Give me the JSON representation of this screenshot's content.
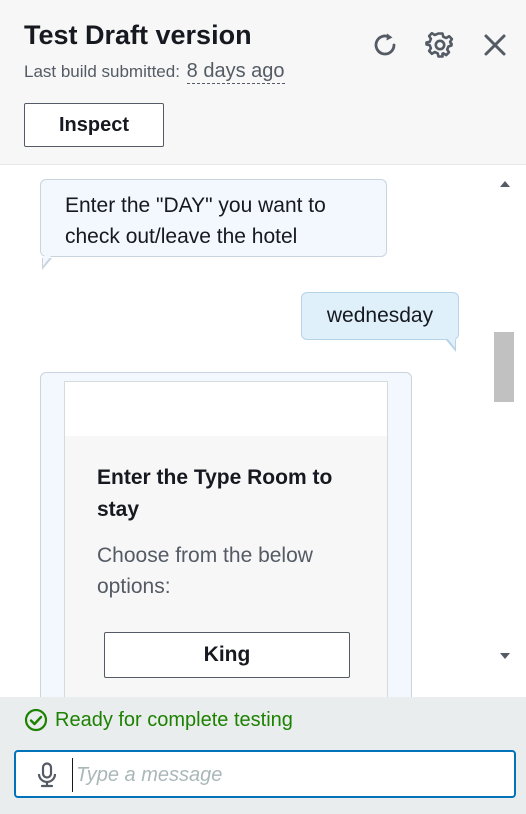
{
  "header": {
    "title": "Test Draft version",
    "subtitle_prefix": "Last build submitted:",
    "subtitle_time": "8 days ago",
    "inspect_label": "Inspect",
    "icons": [
      "refresh-icon",
      "gear-icon",
      "close-icon"
    ]
  },
  "conversation": {
    "bot_message": "Enter the \"DAY\" you want to check out/leave the hotel",
    "user_message": "wednesday",
    "card": {
      "title": "Enter the Type Room to stay",
      "subtitle": "Choose from the below options:",
      "options": [
        "King"
      ]
    }
  },
  "footer": {
    "status_text": "Ready for complete testing",
    "input_placeholder": "Type a message",
    "input_value": ""
  },
  "colors": {
    "success": "#1d8102",
    "focus": "#0073bb",
    "bot_bubble": "#f2f8fd",
    "user_bubble": "#dff0fb"
  }
}
